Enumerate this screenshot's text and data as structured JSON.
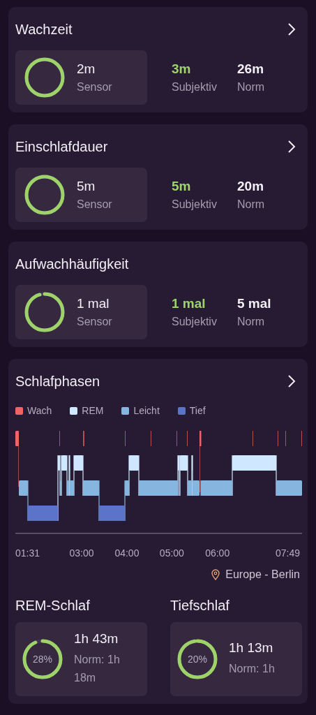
{
  "metric_cards": [
    {
      "title": "Wachzeit",
      "has_chevron": true,
      "sensor": {
        "value": "2m",
        "label": "Sensor",
        "level": 1
      },
      "subjective": {
        "value": "3m",
        "label": "Subjektiv"
      },
      "norm": {
        "value": "26m",
        "label": "Norm"
      }
    },
    {
      "title": "Einschlafdauer",
      "has_chevron": true,
      "sensor": {
        "value": "5m",
        "label": "Sensor",
        "level": 1
      },
      "subjective": {
        "value": "5m",
        "label": "Subjektiv"
      },
      "norm": {
        "value": "20m",
        "label": "Norm"
      }
    },
    {
      "title": "Aufwachhäufigkeit",
      "has_chevron": false,
      "sensor": {
        "value": "1 mal",
        "label": "Sensor",
        "level": 0.95
      },
      "subjective": {
        "value": "1 mal",
        "label": "Subjektiv"
      },
      "norm": {
        "value": "5 mal",
        "label": "Norm"
      }
    }
  ],
  "sleep_phases": {
    "title": "Schlafphasen",
    "has_chevron": true,
    "legend": [
      {
        "label": "Wach",
        "color": "#ef6464"
      },
      {
        "label": "REM",
        "color": "#cfe8ff"
      },
      {
        "label": "Leicht",
        "color": "#86b6e0"
      },
      {
        "label": "Tief",
        "color": "#5b73c9"
      }
    ],
    "time_labels": [
      "01:31",
      "03:00",
      "04:00",
      "05:00",
      "06:00",
      "07:49"
    ],
    "location": "Europe - Berlin",
    "stats": [
      {
        "title": "REM-Schlaf",
        "percent": "28%",
        "level": 0.93,
        "value": "1h 43m",
        "norm": "Norm: 1h 18m"
      },
      {
        "title": "Tiefschlaf",
        "percent": "20%",
        "level": 0.97,
        "value": "1h 13m",
        "norm": "Norm: 1h"
      }
    ]
  }
}
